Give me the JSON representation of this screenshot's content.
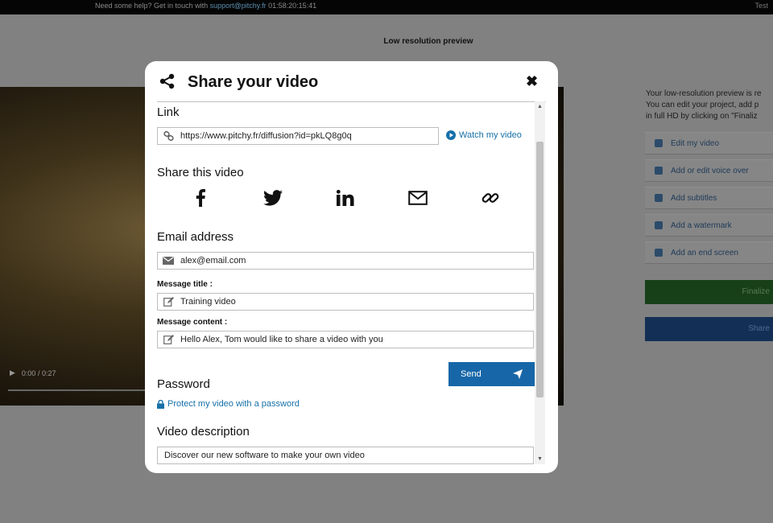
{
  "topbar": {
    "help_text": "Need some help? Get in touch with",
    "support_link": "support@pitchy.fr",
    "timestamp": "01:58:20:15:41",
    "right_text": "Test"
  },
  "page": {
    "preview_title": "Low resolution preview",
    "video_time": "0:00 / 0:27",
    "side_text": [
      "Your low-resolution preview is re",
      "You can edit your project, add p",
      "in full HD by clicking on \"Finaliz"
    ],
    "actions": [
      {
        "label": "Edit my video"
      },
      {
        "label": "Add or edit voice over"
      },
      {
        "label": "Add subtitles"
      },
      {
        "label": "Add a watermark"
      },
      {
        "label": "Add an end screen"
      }
    ],
    "finalize_label": "Finalize",
    "share_label": "Share"
  },
  "modal": {
    "title": "Share your video",
    "link_section": "Link",
    "link_value": "https://www.pitchy.fr/diffusion?id=pkLQ8g0q",
    "watch_label": "Watch my video",
    "share_section": "Share this video",
    "social_icons": [
      "facebook-icon",
      "twitter-icon",
      "linkedin-icon",
      "email-icon",
      "link-icon"
    ],
    "email_section": "Email address",
    "email_value": "alex@email.com",
    "message_title_label": "Message title :",
    "message_title_value": "Training video",
    "message_content_label": "Message content :",
    "message_content_value": "Hello Alex, Tom would like to share a video with you",
    "send_label": "Send",
    "password_section": "Password",
    "password_link": "Protect my video with a password",
    "description_section": "Video description",
    "description_value": "Discover our new software to make your own video"
  },
  "colors": {
    "accent": "#1767a8",
    "link": "#1670a8",
    "overlay": "#818181"
  }
}
